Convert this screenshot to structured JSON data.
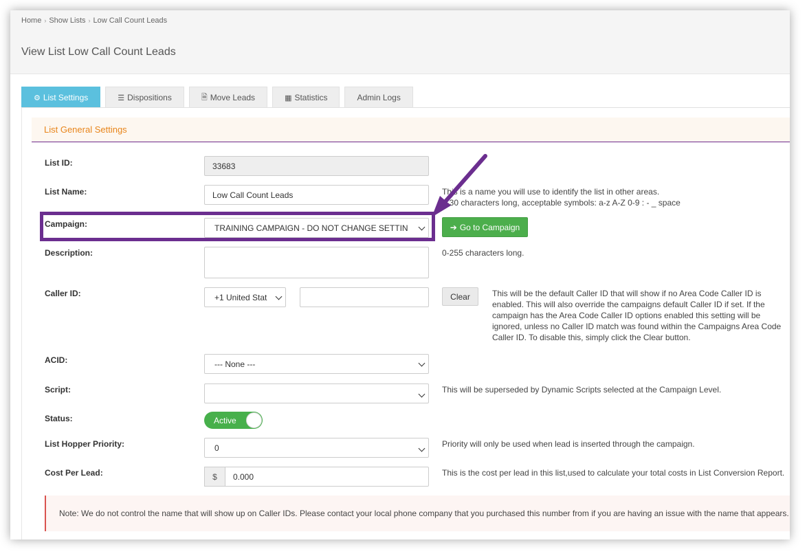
{
  "breadcrumb": [
    "Home",
    "Show Lists",
    "Low Call Count Leads"
  ],
  "page_title": "View List Low Call Count Leads",
  "tabs": [
    {
      "label": "List Settings",
      "icon": "gear-icon",
      "active": true
    },
    {
      "label": "Dispositions",
      "icon": "list-icon",
      "active": false
    },
    {
      "label": "Move Leads",
      "icon": "file-icon",
      "active": false
    },
    {
      "label": "Statistics",
      "icon": "table-icon",
      "active": false
    },
    {
      "label": "Admin Logs",
      "icon": "",
      "active": false
    }
  ],
  "panel_heading": "List General Settings",
  "form": {
    "list_id": {
      "label": "List ID:",
      "value": "33683"
    },
    "list_name": {
      "label": "List Name:",
      "value": "Low Call Count Leads",
      "help_line1": "This is a name you will use to identify the list in other areas.",
      "help_line2": "1-30 characters long, acceptable symbols: a-z A-Z 0-9 : - _ space"
    },
    "campaign": {
      "label": "Campaign:",
      "value": "TRAINING CAMPAIGN - DO NOT CHANGE SETTIN",
      "button": "Go to Campaign"
    },
    "description": {
      "label": "Description:",
      "value": "",
      "help": "0-255 characters long."
    },
    "caller_id": {
      "label": "Caller ID:",
      "country": "+1 United Stat",
      "number": "",
      "clear_button": "Clear",
      "help_lines": [
        "This will be the default Caller ID that will show if no Area Code Caller ID is",
        "enabled. This will also override the campaigns default Caller ID if set. If the",
        "campaign has the Area Code Caller ID options enabled this setting will be",
        "ignored, unless no Caller ID match was found within the Campaigns Area Code",
        "Caller ID. To disable this, simply click the Clear button."
      ]
    },
    "acid": {
      "label": "ACID:",
      "value": "--- None ---"
    },
    "script": {
      "label": "Script:",
      "value": "",
      "help": "This will be superseded by Dynamic Scripts selected at the Campaign Level."
    },
    "status": {
      "label": "Status:",
      "value": "Active"
    },
    "hopper_priority": {
      "label": "List Hopper Priority:",
      "value": "0",
      "help": "Priority will only be used when lead is inserted through the campaign."
    },
    "cost_per_lead": {
      "label": "Cost Per Lead:",
      "currency": "$",
      "value": "0.000",
      "help": "This is the cost per lead in this list,used to calculate your total costs in List Conversion Report."
    }
  },
  "note": "Note: We do not control the name that will show up on Caller IDs. Please contact your local phone company that you purchased this number from if you are having an issue with the name that appears.",
  "colors": {
    "annotation": "#6b2e8f",
    "active_tab": "#5bc0de",
    "success": "#4cae4c",
    "heading_text": "#e8851b"
  }
}
